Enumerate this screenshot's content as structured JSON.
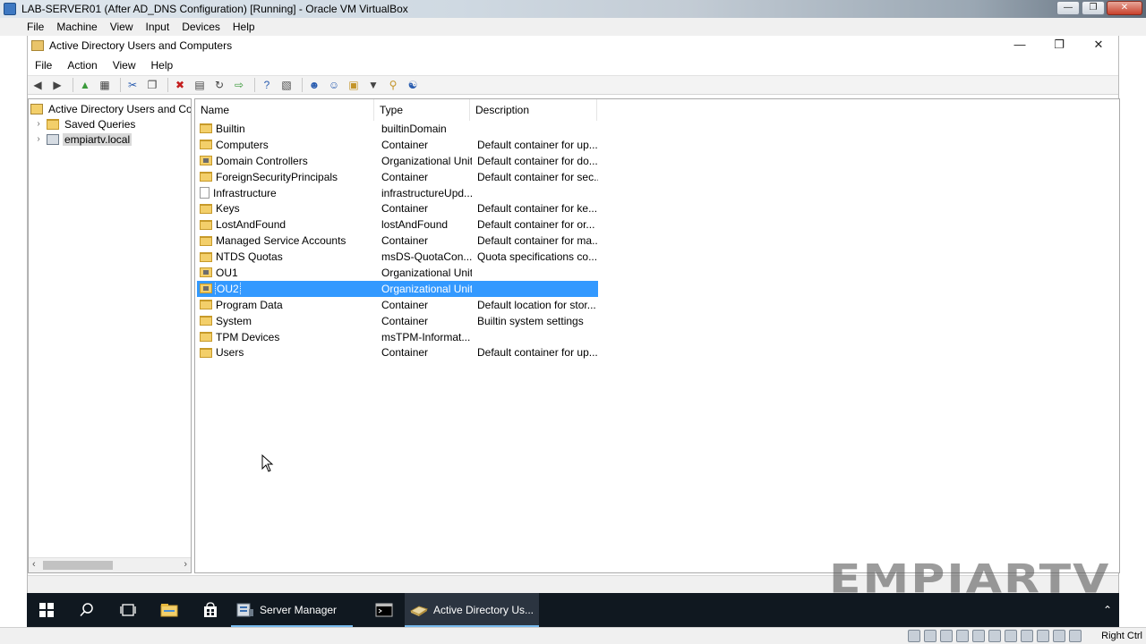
{
  "vbox": {
    "title": "LAB-SERVER01 (After AD_DNS Configuration) [Running] - Oracle VM VirtualBox",
    "menu": [
      "File",
      "Machine",
      "View",
      "Input",
      "Devices",
      "Help"
    ],
    "host_key": "Right Ctrl"
  },
  "mmc": {
    "title": "Active Directory Users and Computers",
    "menu": [
      "File",
      "Action",
      "View",
      "Help"
    ]
  },
  "tree": {
    "root": "Active Directory Users and Com",
    "items": [
      {
        "label": "Saved Queries",
        "icon": "folder-icon"
      },
      {
        "label": "empiartv.local",
        "icon": "domain-icon"
      }
    ]
  },
  "list": {
    "columns": [
      "Name",
      "Type",
      "Description"
    ],
    "rows": [
      {
        "name": "Builtin",
        "type": "builtinDomain",
        "description": "",
        "icon": "folder-icon"
      },
      {
        "name": "Computers",
        "type": "Container",
        "description": "Default container for up...",
        "icon": "folder-icon"
      },
      {
        "name": "Domain Controllers",
        "type": "Organizational Unit",
        "description": "Default container for do...",
        "icon": "ou-icon"
      },
      {
        "name": "ForeignSecurityPrincipals",
        "type": "Container",
        "description": "Default container for sec...",
        "icon": "folder-icon"
      },
      {
        "name": "Infrastructure",
        "type": "infrastructureUpd...",
        "description": "",
        "icon": "document-icon"
      },
      {
        "name": "Keys",
        "type": "Container",
        "description": "Default container for ke...",
        "icon": "folder-icon"
      },
      {
        "name": "LostAndFound",
        "type": "lostAndFound",
        "description": "Default container for or...",
        "icon": "folder-icon"
      },
      {
        "name": "Managed Service Accounts",
        "type": "Container",
        "description": "Default container for ma...",
        "icon": "folder-icon"
      },
      {
        "name": "NTDS Quotas",
        "type": "msDS-QuotaCon...",
        "description": "Quota specifications co...",
        "icon": "folder-icon"
      },
      {
        "name": "OU1",
        "type": "Organizational Unit",
        "description": "",
        "icon": "ou-icon"
      },
      {
        "name": "OU2",
        "type": "Organizational Unit",
        "description": "",
        "icon": "ou-icon",
        "selected": true
      },
      {
        "name": "Program Data",
        "type": "Container",
        "description": "Default location for stor...",
        "icon": "folder-icon"
      },
      {
        "name": "System",
        "type": "Container",
        "description": "Builtin system settings",
        "icon": "folder-icon"
      },
      {
        "name": "TPM Devices",
        "type": "msTPM-Informat...",
        "description": "",
        "icon": "folder-icon"
      },
      {
        "name": "Users",
        "type": "Container",
        "description": "Default container for up...",
        "icon": "folder-icon"
      }
    ]
  },
  "taskbar": {
    "server_manager": "Server Manager",
    "ad_users": "Active Directory Us..."
  },
  "watermark": "EMPIARTV",
  "colors": {
    "selection": "#3399ff",
    "taskbar": "#101820",
    "folder": "#f3cf6a"
  }
}
